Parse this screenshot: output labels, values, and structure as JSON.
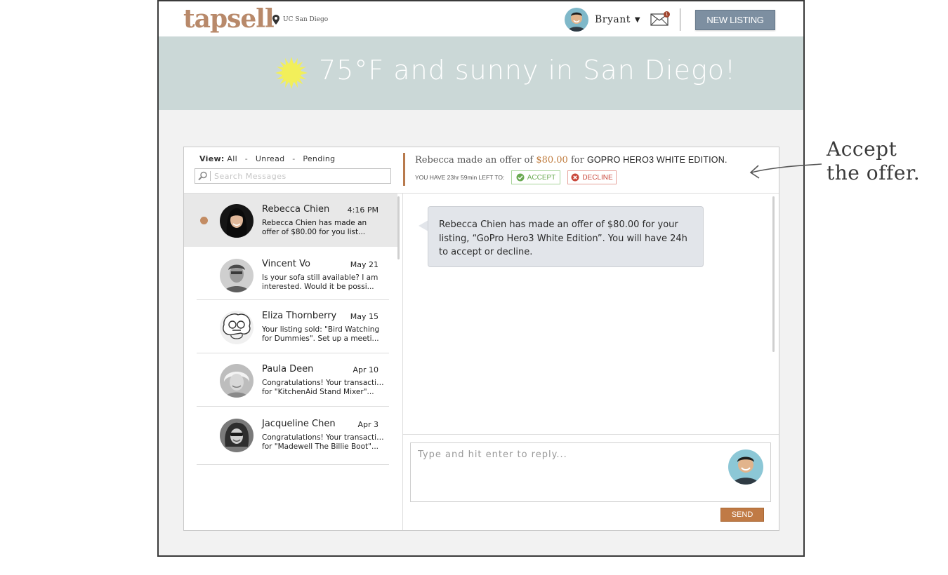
{
  "header": {
    "logo": "tapsell",
    "location": "UC San Diego",
    "user_name": "Bryant",
    "mail_badge": "1",
    "new_listing_label": "NEW LISTING"
  },
  "banner": {
    "text": "75°F and sunny in San Diego!"
  },
  "filters": {
    "label": "View:",
    "options": [
      "All",
      "Unread",
      "Pending"
    ],
    "separator": "-"
  },
  "search": {
    "placeholder": "Search Messages"
  },
  "offer": {
    "prefix": "Rebecca made an offer of",
    "price": "$80.00",
    "middle": "for",
    "item": "GOPRO HERO3 WHITE EDITION.",
    "deadline": "YOU HAVE 23hr 59min LEFT TO:",
    "accept_label": "ACCEPT",
    "decline_label": "DECLINE"
  },
  "conversations": [
    {
      "name": "Rebecca Chien",
      "time": "4:16 PM",
      "preview": [
        "Rebecca Chien has made an",
        "offer of $80.00 for you list..."
      ],
      "unread": true
    },
    {
      "name": "Vincent Vo",
      "time": "May 21",
      "preview": [
        "Is your sofa still available? I am",
        "interested. Would it be possi..."
      ]
    },
    {
      "name": "Eliza Thornberry",
      "time": "May 15",
      "preview": [
        "Your listing sold: \"Bird Watching",
        "for Dummies\". Set up a meeti..."
      ]
    },
    {
      "name": "Paula Deen",
      "time": "Apr 10",
      "preview": [
        "Congratulations! Your transaction",
        "for \"KitchenAid Stand Mixer\"..."
      ]
    },
    {
      "name": "Jacqueline Chen",
      "time": "Apr 3",
      "preview": [
        "Congratulations! Your transaction",
        "for \"Madewell The Billie Boot\"..."
      ]
    }
  ],
  "chat": {
    "message": "Rebecca Chien has made an offer of $80.00 for your listing, “GoPro Hero3 White Edition”. You will have 24h to accept or decline."
  },
  "reply": {
    "placeholder": "Type and hit enter to reply...",
    "send_label": "SEND"
  },
  "annotation": {
    "line1": "Accept",
    "line2": "the offer."
  },
  "colors": {
    "brand": "#b8896a",
    "banner": "#cbd8d7",
    "accent_button": "#7d8fa1",
    "price": "#c07c3e",
    "accept": "#6aaa52",
    "decline": "#c9473b",
    "send": "#c07a45"
  },
  "icons": [
    "location-pin-icon",
    "chevron-down-icon",
    "mail-icon",
    "sun-icon",
    "search-icon",
    "check-circle-icon",
    "x-circle-icon",
    "arrow-icon"
  ]
}
